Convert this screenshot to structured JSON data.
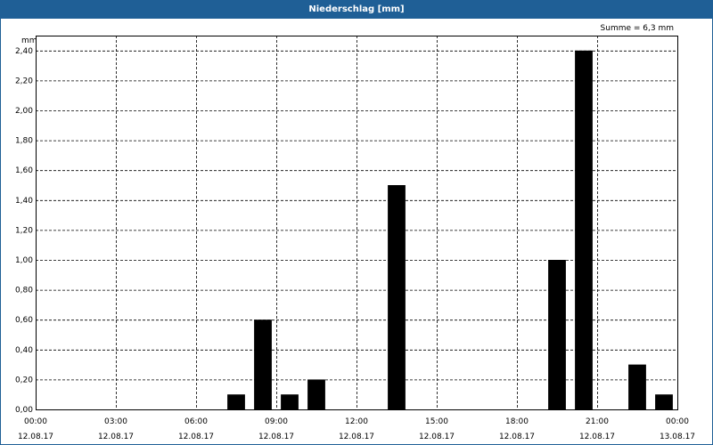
{
  "window": {
    "title": "Niederschlag [mm]"
  },
  "chart_data": {
    "type": "bar",
    "title": "Niederschlag [mm]",
    "ylabel": "mm",
    "annotation": "Summe = 6,3 mm",
    "ylim": [
      0,
      2.5
    ],
    "y_ticks": [
      0,
      0.2,
      0.4,
      0.6,
      0.8,
      1.0,
      1.2,
      1.4,
      1.6,
      1.8,
      2.0,
      2.2,
      2.4
    ],
    "y_tick_labels": [
      "0,00",
      "0,20",
      "0,40",
      "0,60",
      "0,80",
      "1,00",
      "1,20",
      "1,40",
      "1,60",
      "1,80",
      "2,00",
      "2,20",
      "2,40"
    ],
    "x_range_hours": [
      0,
      24
    ],
    "x_ticks_hours": [
      0,
      3,
      6,
      9,
      12,
      15,
      18,
      21,
      24
    ],
    "x_tick_times": [
      "00:00",
      "03:00",
      "06:00",
      "09:00",
      "12:00",
      "15:00",
      "18:00",
      "21:00",
      "00:00"
    ],
    "x_tick_dates": [
      "12.08.17",
      "12.08.17",
      "12.08.17",
      "12.08.17",
      "12.08.17",
      "12.08.17",
      "12.08.17",
      "12.08.17",
      "13.08.17"
    ],
    "grid": true,
    "bars": [
      {
        "hour": 7.5,
        "value": 0.1
      },
      {
        "hour": 8.5,
        "value": 0.6
      },
      {
        "hour": 9.5,
        "value": 0.1
      },
      {
        "hour": 10.5,
        "value": 0.2
      },
      {
        "hour": 13.5,
        "value": 1.5
      },
      {
        "hour": 19.5,
        "value": 1.0
      },
      {
        "hour": 20.5,
        "value": 2.4
      },
      {
        "hour": 22.5,
        "value": 0.3
      },
      {
        "hour": 23.5,
        "value": 0.1
      }
    ],
    "bar_color": "#000000"
  }
}
